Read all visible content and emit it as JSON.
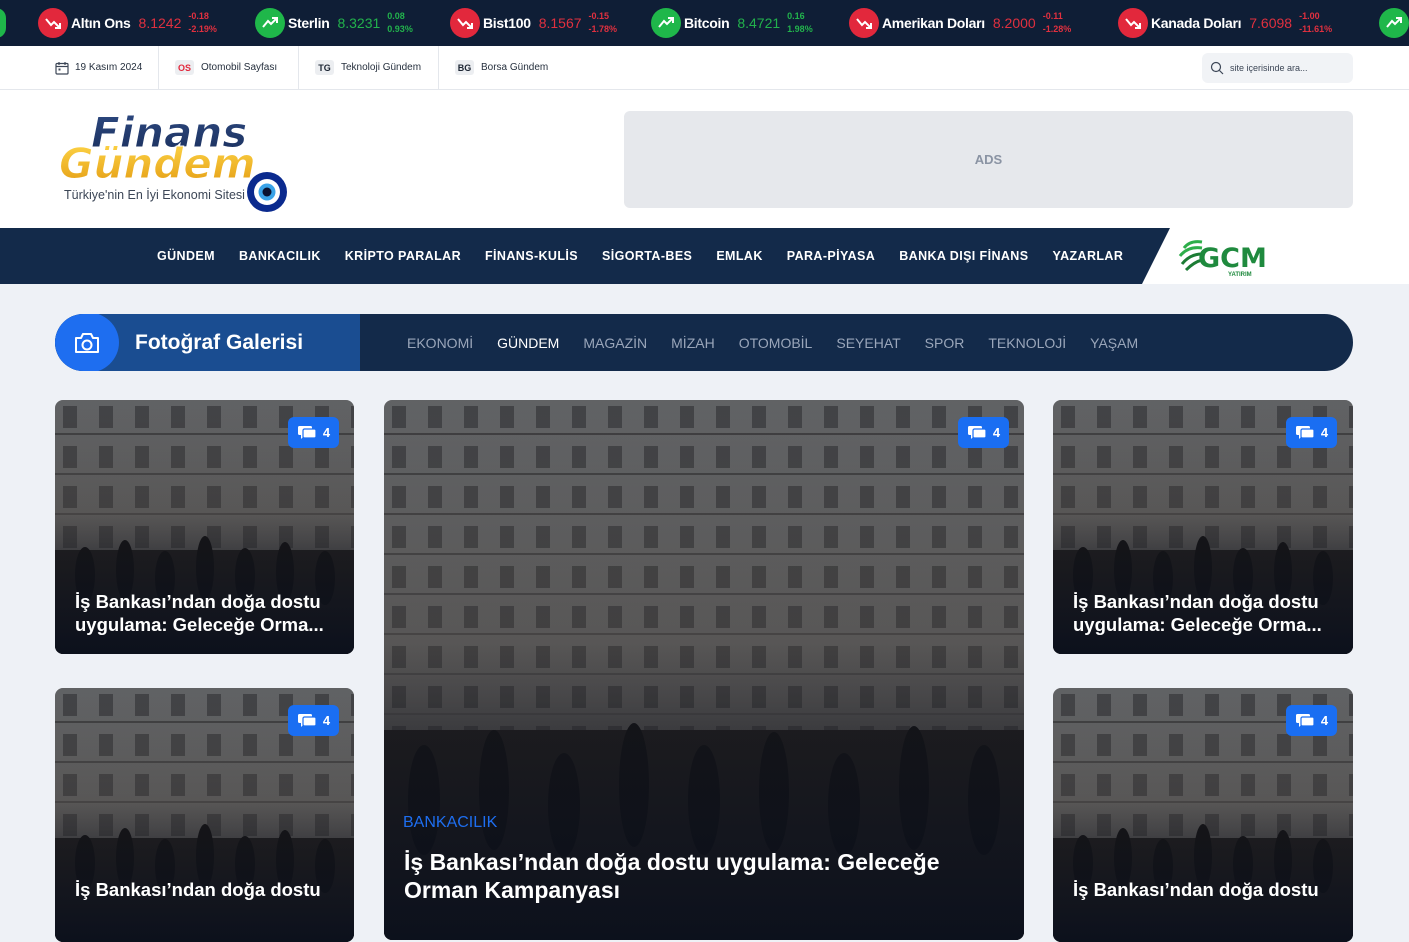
{
  "ticker": [
    {
      "name": "Altın Ons",
      "price": "8.1242",
      "change": "-0.18",
      "percent": "-2.19%",
      "dir": "down"
    },
    {
      "name": "Sterlin",
      "price": "8.3231",
      "change": "0.08",
      "percent": "0.93%",
      "dir": "up"
    },
    {
      "name": "Bist100",
      "price": "8.1567",
      "change": "-0.15",
      "percent": "-1.78%",
      "dir": "down"
    },
    {
      "name": "Bitcoin",
      "price": "8.4721",
      "change": "0.16",
      "percent": "1.98%",
      "dir": "up"
    },
    {
      "name": "Amerikan Doları",
      "price": "8.2000",
      "change": "-0.11",
      "percent": "-1.28%",
      "dir": "down"
    },
    {
      "name": "Kanada Doları",
      "price": "7.6098",
      "change": "-1.00",
      "percent": "-11.61%",
      "dir": "down"
    }
  ],
  "topbar": {
    "date": "19 Kasım 2024",
    "links": [
      {
        "badge": "OS",
        "label": "Otomobil Sayfası",
        "color": "#e2283c"
      },
      {
        "badge": "TG",
        "label": "Teknoloji Gündem",
        "color": "#1c2533"
      },
      {
        "badge": "BG",
        "label": "Borsa Gündem",
        "color": "#1c2533"
      }
    ],
    "search_placeholder": "site içerisinde ara..."
  },
  "header": {
    "logo_line1": "Finans",
    "logo_line2": "Gündem",
    "logo_tagline": "Türkiye'nin En İyi Ekonomi Sitesi",
    "ads_label": "ADS"
  },
  "nav": {
    "items": [
      "GÜNDEM",
      "BANKACILIK",
      "KRİPTO PARALAR",
      "FİNANS-KULİS",
      "SİGORTA-BES",
      "EMLAK",
      "PARA-PİYASA",
      "BANKA DIŞI FİNANS",
      "YAZARLAR"
    ],
    "partner_logo": "GCM",
    "partner_sub": "YATIRIM"
  },
  "gallery": {
    "title": "Fotoğraf Galerisi",
    "tabs": [
      "EKONOMİ",
      "GÜNDEM",
      "MAGAZİN",
      "MİZAH",
      "OTOMOBİL",
      "SEYEHAT",
      "SPOR",
      "TEKNOLOJİ",
      "YAŞAM"
    ],
    "active_tab": "GÜNDEM"
  },
  "cards": {
    "small": [
      {
        "title": "İş Bankası’ndan doğa dostu uygulama: Geleceğe Orma...",
        "comments": "4"
      },
      {
        "title": "İş Bankası’ndan doğa dostu uygulama: Geleceğe Orma...",
        "comments": "4"
      },
      {
        "title": "İş Bankası’ndan doğa dostu",
        "comments": "4"
      },
      {
        "title": "İş Bankası’ndan doğa dostu",
        "comments": "4"
      }
    ],
    "featured": {
      "category": "BANKACILIK",
      "title": "İş Bankası’ndan doğa dostu uygulama: Geleceğe Orman Kampanyası",
      "comments": "4"
    }
  },
  "colors": {
    "navy": "#132a4a",
    "accent_blue": "#1e6ef0",
    "down_red": "#e2283c",
    "up_green": "#1fb74a"
  }
}
